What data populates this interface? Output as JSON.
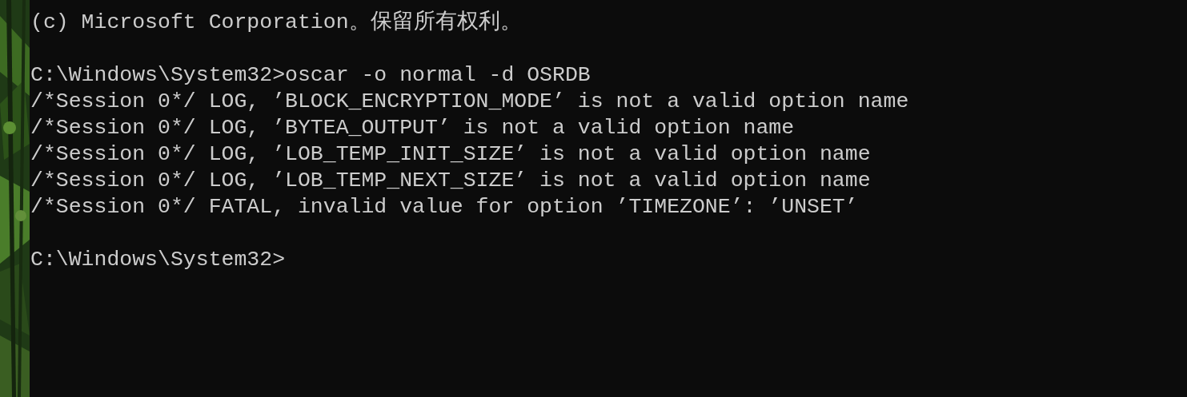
{
  "console": {
    "blocks": [
      {
        "lines": [
          "(c) Microsoft Corporation。保留所有权利。"
        ]
      },
      {
        "lines": [
          "C:\\Windows\\System32>oscar -o normal -d OSRDB",
          "/*Session 0*/ LOG, ’BLOCK_ENCRYPTION_MODE’ is not a valid option name",
          "/*Session 0*/ LOG, ’BYTEA_OUTPUT’ is not a valid option name",
          "/*Session 0*/ LOG, ’LOB_TEMP_INIT_SIZE’ is not a valid option name",
          "/*Session 0*/ LOG, ’LOB_TEMP_NEXT_SIZE’ is not a valid option name",
          "/*Session 0*/ FATAL, invalid value for option ’TIMEZONE’: ’UNSET’"
        ]
      },
      {
        "lines": [
          "C:\\Windows\\System32>"
        ]
      }
    ]
  }
}
